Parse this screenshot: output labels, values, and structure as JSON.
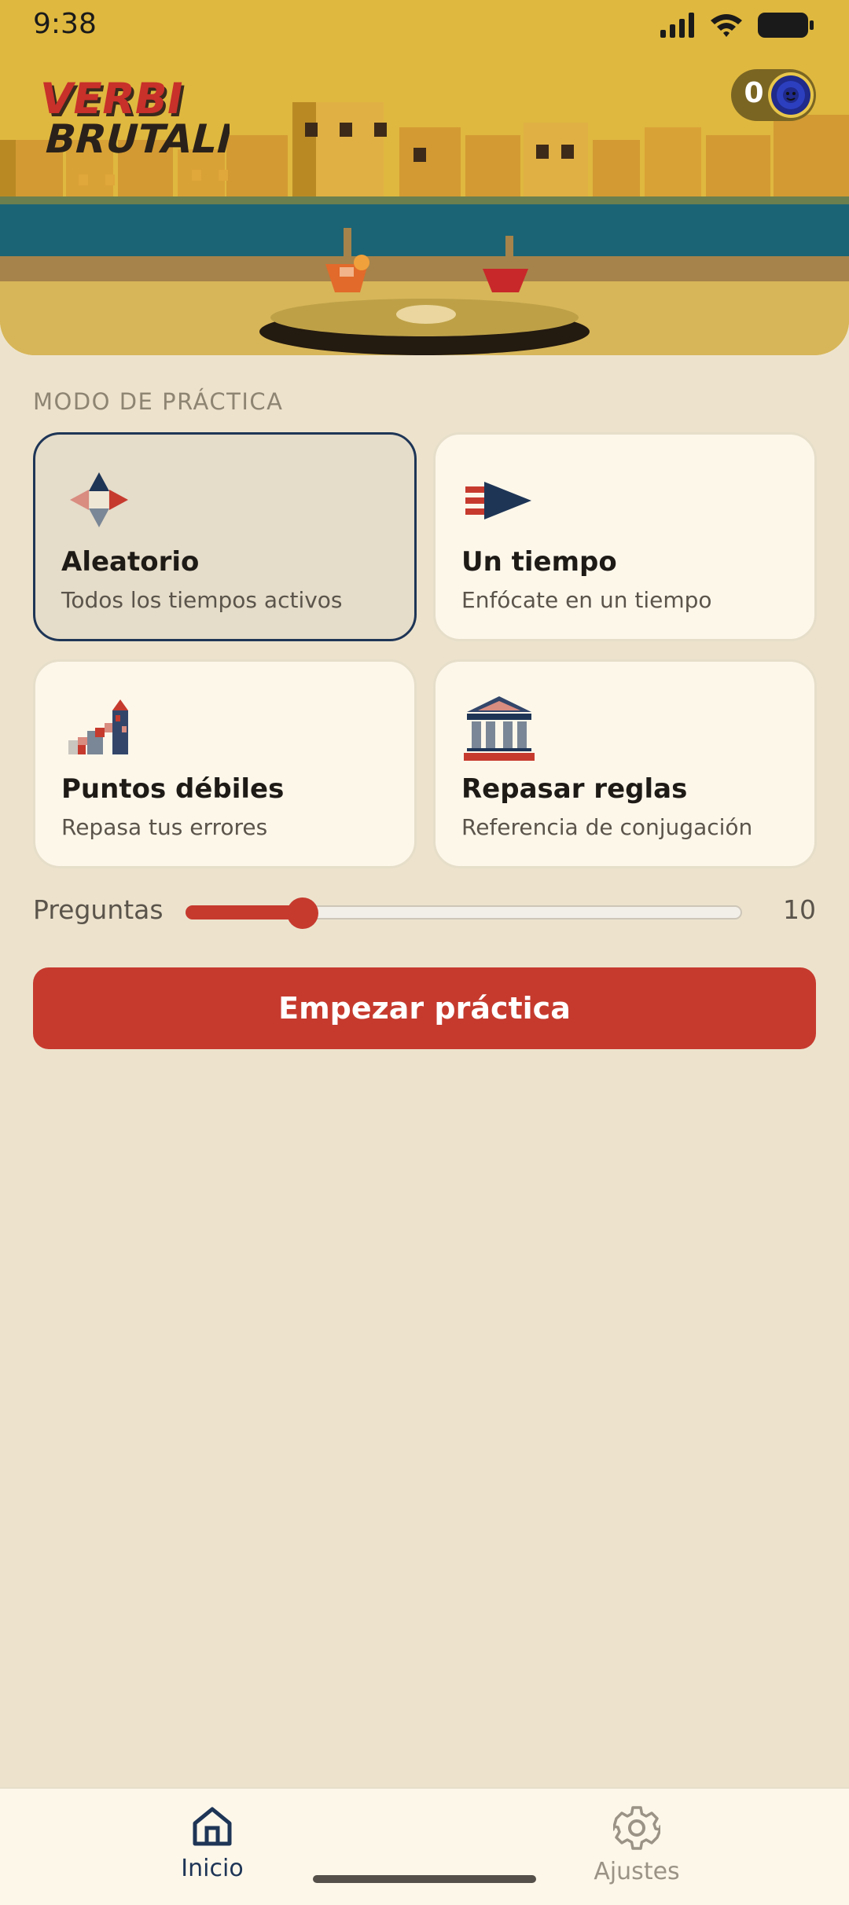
{
  "status_bar": {
    "time": "9:38"
  },
  "header": {
    "logo_text_line1": "VERBI",
    "logo_text_line2": "BRUTALI",
    "coin_count": "0"
  },
  "practice": {
    "section_label": "MODO DE PRÁCTICA",
    "modes": [
      {
        "title": "Aleatorio",
        "subtitle": "Todos los tiempos activos",
        "icon": "compass-arrows-icon",
        "selected": true
      },
      {
        "title": "Un tiempo",
        "subtitle": "Enfócate en un tiempo",
        "icon": "arrow-flag-icon",
        "selected": false
      },
      {
        "title": "Puntos débiles",
        "subtitle": "Repasa tus errores",
        "icon": "stairs-tower-icon",
        "selected": false
      },
      {
        "title": "Repasar reglas",
        "subtitle": "Referencia de conjugación",
        "icon": "temple-icon",
        "selected": false
      }
    ],
    "questions_label": "Preguntas",
    "questions_value": "10",
    "questions_slider_fraction": 0.21,
    "start_label": "Empezar práctica"
  },
  "nav": {
    "items": [
      {
        "label": "Inicio",
        "icon": "home-icon",
        "active": true
      },
      {
        "label": "Ajustes",
        "icon": "gear-icon",
        "active": false
      }
    ]
  },
  "colors": {
    "accent": "#c63a2e",
    "navy": "#1e3556",
    "background": "#ede3cd",
    "card": "#fdf7ea",
    "hero_yellow": "#dfb83f"
  }
}
